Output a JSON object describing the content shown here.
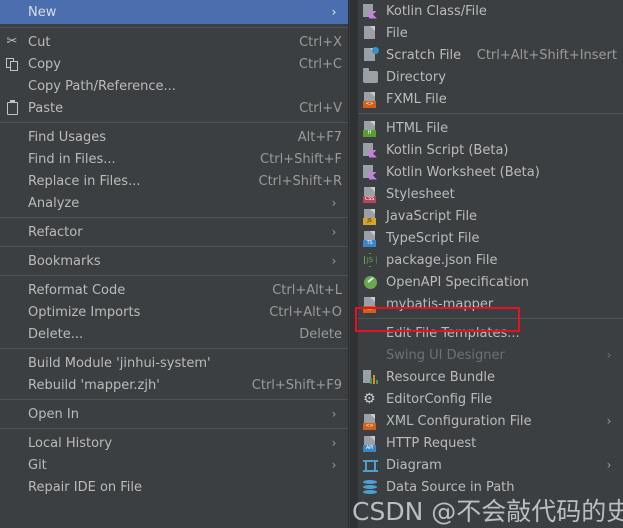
{
  "theme": {
    "menu_bg": "#3c3f41",
    "selected_bg": "#4b6eaf",
    "text": "#bbbbbb",
    "shortcut_text": "#9a9a9a",
    "separator": "#4f5355",
    "disabled_text": "#6e7173",
    "highlight_box": "#e81123"
  },
  "context_menu": {
    "header": {
      "label": "New",
      "arrow": "›",
      "selected": true,
      "icon": "none"
    },
    "groups": [
      {
        "items": [
          {
            "icon": "cut-icon",
            "label": "Cut",
            "accel": "t",
            "shortcut": "Ctrl+X",
            "arrow": ""
          },
          {
            "icon": "copy-icon",
            "label": "Copy",
            "accel": "C",
            "shortcut": "Ctrl+C",
            "arrow": ""
          },
          {
            "icon": "none",
            "label": "Copy Path/Reference...",
            "accel": "",
            "shortcut": "",
            "arrow": ""
          },
          {
            "icon": "paste-icon",
            "label": "Paste",
            "accel": "P",
            "shortcut": "Ctrl+V",
            "arrow": ""
          }
        ]
      },
      {
        "items": [
          {
            "icon": "none",
            "label": "Find Usages",
            "accel": "U",
            "shortcut": "Alt+F7",
            "arrow": ""
          },
          {
            "icon": "none",
            "label": "Find in Files...",
            "accel": "",
            "shortcut": "Ctrl+Shift+F",
            "arrow": ""
          },
          {
            "icon": "none",
            "label": "Replace in Files...",
            "accel": "a",
            "shortcut": "Ctrl+Shift+R",
            "arrow": ""
          },
          {
            "icon": "none",
            "label": "Analyze",
            "accel": "z",
            "shortcut": "",
            "arrow": "›"
          }
        ]
      },
      {
        "items": [
          {
            "icon": "none",
            "label": "Refactor",
            "accel": "e",
            "shortcut": "",
            "arrow": "›"
          }
        ]
      },
      {
        "items": [
          {
            "icon": "none",
            "label": "Bookmarks",
            "accel": "",
            "shortcut": "",
            "arrow": "›"
          }
        ]
      },
      {
        "items": [
          {
            "icon": "none",
            "label": "Reformat Code",
            "accel": "R",
            "shortcut": "Ctrl+Alt+L",
            "arrow": ""
          },
          {
            "icon": "none",
            "label": "Optimize Imports",
            "accel": "z",
            "shortcut": "Ctrl+Alt+O",
            "arrow": ""
          },
          {
            "icon": "none",
            "label": "Delete...",
            "accel": "D",
            "shortcut": "Delete",
            "arrow": ""
          }
        ]
      },
      {
        "items": [
          {
            "icon": "none",
            "label": "Build Module 'jinhui-system'",
            "accel": "M",
            "shortcut": "",
            "arrow": ""
          },
          {
            "icon": "none",
            "label": "Rebuild 'mapper.zjh'",
            "accel": "b",
            "shortcut": "Ctrl+Shift+F9",
            "arrow": ""
          }
        ]
      },
      {
        "items": [
          {
            "icon": "none",
            "label": "Open In",
            "accel": "",
            "shortcut": "",
            "arrow": "›"
          }
        ]
      },
      {
        "items": [
          {
            "icon": "none",
            "label": "Local History",
            "accel": "H",
            "shortcut": "",
            "arrow": "›"
          },
          {
            "icon": "none",
            "label": "Git",
            "accel": "G",
            "shortcut": "",
            "arrow": "›"
          },
          {
            "icon": "none",
            "label": "Repair IDE on File",
            "accel": "",
            "shortcut": "",
            "arrow": ""
          }
        ]
      }
    ]
  },
  "new_submenu": {
    "groups": [
      {
        "items": [
          {
            "icon": "kotlin-file-icon",
            "label": "Kotlin Class/File",
            "shortcut": "",
            "arrow": "",
            "disabled": false,
            "highlighted": false
          },
          {
            "icon": "file-icon",
            "label": "File",
            "shortcut": "",
            "arrow": "",
            "disabled": false,
            "highlighted": false
          },
          {
            "icon": "scratch-file-icon",
            "label": "Scratch File",
            "shortcut": "Ctrl+Alt+Shift+Insert",
            "arrow": "",
            "disabled": false,
            "highlighted": false
          },
          {
            "icon": "directory-icon",
            "label": "Directory",
            "shortcut": "",
            "arrow": "",
            "disabled": false,
            "highlighted": false
          },
          {
            "icon": "fxml-file-icon",
            "label": "FXML File",
            "shortcut": "",
            "arrow": "",
            "disabled": false,
            "highlighted": false
          }
        ]
      },
      {
        "items": [
          {
            "icon": "html-file-icon",
            "label": "HTML File",
            "shortcut": "",
            "arrow": "",
            "disabled": false,
            "highlighted": false
          },
          {
            "icon": "kotlin-script-icon",
            "label": "Kotlin Script (Beta)",
            "shortcut": "",
            "arrow": "",
            "disabled": false,
            "highlighted": false
          },
          {
            "icon": "kotlin-worksheet-icon",
            "label": "Kotlin Worksheet (Beta)",
            "shortcut": "",
            "arrow": "",
            "disabled": false,
            "highlighted": false
          },
          {
            "icon": "stylesheet-icon",
            "label": "Stylesheet",
            "shortcut": "",
            "arrow": "",
            "disabled": false,
            "highlighted": false
          },
          {
            "icon": "javascript-file-icon",
            "label": "JavaScript File",
            "shortcut": "",
            "arrow": "",
            "disabled": false,
            "highlighted": false
          },
          {
            "icon": "typescript-file-icon",
            "label": "TypeScript File",
            "shortcut": "",
            "arrow": "",
            "disabled": false,
            "highlighted": false
          },
          {
            "icon": "packagejson-icon",
            "label": "package.json File",
            "shortcut": "",
            "arrow": "",
            "disabled": false,
            "highlighted": false
          },
          {
            "icon": "openapi-icon",
            "label": "OpenAPI Specification",
            "shortcut": "",
            "arrow": "",
            "disabled": false,
            "highlighted": false
          },
          {
            "icon": "mybatis-mapper-icon",
            "label": "mybatis-mapper",
            "shortcut": "",
            "arrow": "",
            "disabled": false,
            "highlighted": true
          }
        ]
      },
      {
        "items": [
          {
            "icon": "none",
            "label": "Edit File Templates...",
            "shortcut": "",
            "arrow": "",
            "disabled": false,
            "highlighted": false
          },
          {
            "icon": "none",
            "label": "Swing UI Designer",
            "shortcut": "",
            "arrow": "›",
            "disabled": true,
            "highlighted": false
          },
          {
            "icon": "resource-bundle-icon",
            "label": "Resource Bundle",
            "shortcut": "",
            "arrow": "",
            "disabled": false,
            "highlighted": false
          },
          {
            "icon": "editorconfig-icon",
            "label": "EditorConfig File",
            "shortcut": "",
            "arrow": "",
            "disabled": false,
            "highlighted": false
          },
          {
            "icon": "xml-config-file-icon",
            "label": "XML Configuration File",
            "shortcut": "",
            "arrow": "›",
            "disabled": false,
            "highlighted": false
          },
          {
            "icon": "http-request-icon",
            "label": "HTTP Request",
            "shortcut": "",
            "arrow": "",
            "disabled": false,
            "highlighted": false
          },
          {
            "icon": "diagram-icon",
            "label": "Diagram",
            "shortcut": "",
            "arrow": "›",
            "disabled": false,
            "highlighted": false
          },
          {
            "icon": "data-source-icon",
            "label": "Data Source in Path",
            "shortcut": "",
            "arrow": "",
            "disabled": false,
            "highlighted": false
          }
        ]
      }
    ]
  },
  "watermark": {
    "text": "CSDN @不会敲代码的史努比"
  }
}
